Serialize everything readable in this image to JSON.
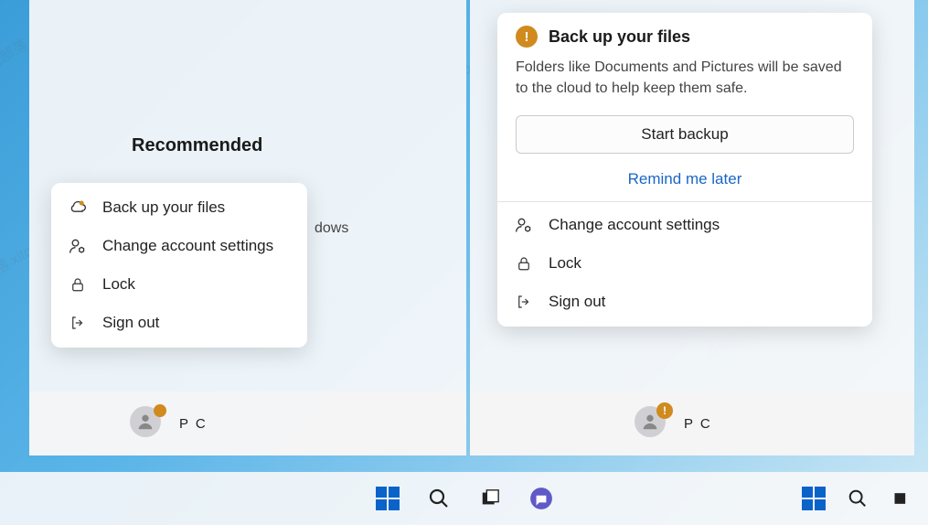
{
  "left": {
    "recommended": "Recommended",
    "partial": "dows",
    "menu": {
      "backup": "Back up your files",
      "account": "Change account settings",
      "lock": "Lock",
      "signout": "Sign out"
    },
    "user": "P C"
  },
  "right": {
    "backup_title": "Back up your files",
    "backup_desc": "Folders like Documents and Pictures will be saved to the cloud to help keep them safe.",
    "start": "Start backup",
    "remind": "Remind me later",
    "menu": {
      "account": "Change account settings",
      "lock": "Lock",
      "signout": "Sign out"
    },
    "user": "P C"
  },
  "watermark_text": "系统部落 xitongbuluo.com"
}
